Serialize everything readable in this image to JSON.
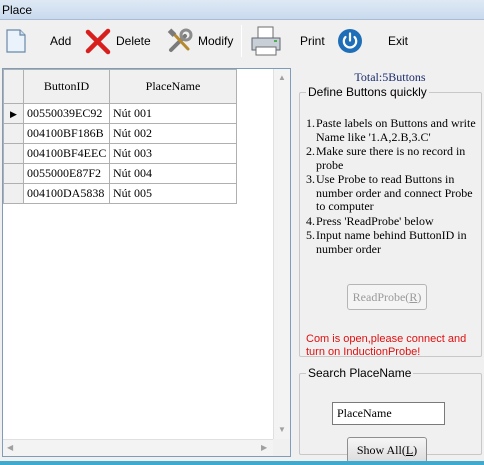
{
  "window": {
    "title": "Place"
  },
  "toolbar": {
    "add": "Add",
    "delete": "Delete",
    "modify": "Modify",
    "print": "Print",
    "exit": "Exit"
  },
  "grid": {
    "columns": [
      "ButtonID",
      "PlaceName"
    ],
    "rows": [
      {
        "id": "00550039EC92",
        "name": "Nút 001"
      },
      {
        "id": "004100BF186B",
        "name": "Nút 002"
      },
      {
        "id": "004100BF4EEC",
        "name": "Nút 003"
      },
      {
        "id": "0055000E87F2",
        "name": "Nút 004"
      },
      {
        "id": "004100DA5838",
        "name": "Nút 005"
      }
    ]
  },
  "panel": {
    "total": "Total:5Buttons",
    "define_legend": "Define Buttons quickly",
    "steps": [
      {
        "n": "1.",
        "text": "Paste labels on Buttons and write Name like '1.A,2.B,3.C'"
      },
      {
        "n": "2.",
        "text": "Make sure there is no record in probe"
      },
      {
        "n": "3.",
        "text": "Use Probe to read Buttons in number order and connect Probe to computer"
      },
      {
        "n": "4.",
        "text": "Press 'ReadProbe' below"
      },
      {
        "n": "5.",
        "text": "Input name behind ButtonID in number order"
      }
    ],
    "readprobe_prefix": "ReadProbe(",
    "readprobe_key": "R",
    "readprobe_suffix": ")",
    "status": "Com is open,please connect and turn on InductionProbe!",
    "search_legend": "Search PlaceName",
    "search_value": "PlaceName",
    "showall_prefix": "Show All(",
    "showall_key": "L",
    "showall_suffix": ")"
  },
  "colors": {
    "status": "#e01010",
    "accent": "#1e6fb8",
    "delete": "#d91e1e"
  }
}
